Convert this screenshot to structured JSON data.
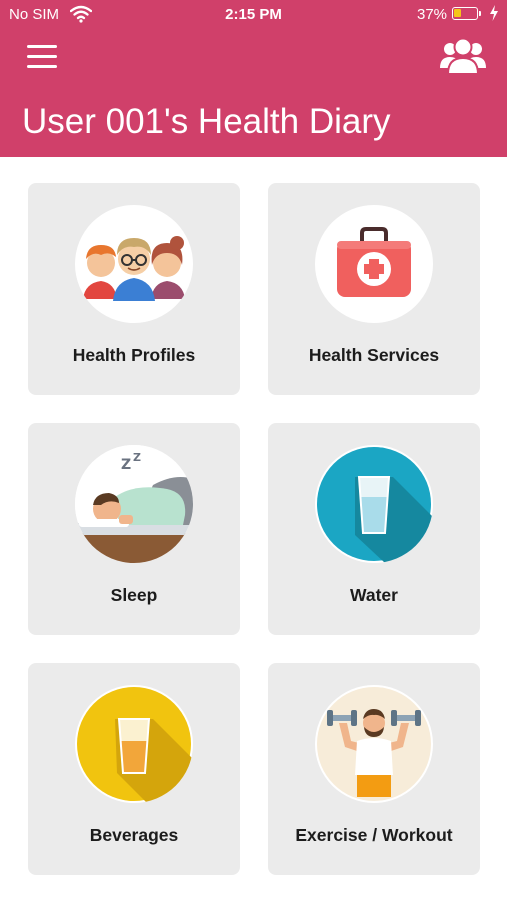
{
  "status_bar": {
    "carrier": "No SIM",
    "time": "2:15 PM",
    "battery_percent": "37%",
    "battery_level": 0.37,
    "wifi_icon": "wifi-icon",
    "charging_icon": "bolt-icon"
  },
  "header": {
    "title": "User 001's Health Diary",
    "menu_icon": "hamburger-menu-icon",
    "profile_icon": "user-group-icon",
    "background_color": "#d0406a"
  },
  "tiles": [
    {
      "label": "Health Profiles",
      "icon": "family-people-icon"
    },
    {
      "label": "Health Services",
      "icon": "first-aid-kit-icon"
    },
    {
      "label": "Sleep",
      "icon": "sleeping-person-icon"
    },
    {
      "label": "Water",
      "icon": "water-glass-icon"
    },
    {
      "label": "Beverages",
      "icon": "beverage-glass-icon"
    },
    {
      "label": "Exercise / Workout",
      "icon": "weightlifter-icon"
    }
  ]
}
